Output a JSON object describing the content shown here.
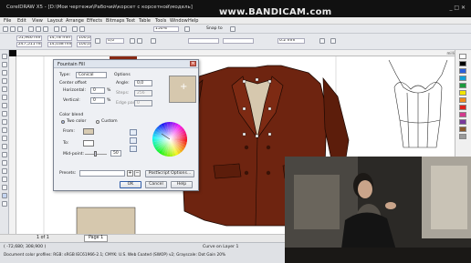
{
  "window": {
    "title": "CorelDRAW X5 - [D:\\Мои чертежи\\Рабочий\\корсет с корсетной\\модель]",
    "watermark": "www.BANDICAM.com",
    "controls": "_ □ ✕"
  },
  "menu": {
    "items": [
      "File",
      "Edit",
      "View",
      "Layout",
      "Arrange",
      "Effects",
      "Bitmaps",
      "Text",
      "Table",
      "Tools",
      "Window",
      "Help"
    ]
  },
  "toolbar": {
    "zoom_value": "150%",
    "snap_to_label": "Snap to",
    "outline_width": "0.2 mm"
  },
  "propertybar": {
    "x_value": "51,946 mm",
    "y_value": "247,511 mm",
    "width_value": "14,78 mm",
    "height_value": "14,038 mm",
    "scale_x": "100,0",
    "scale_y": "100,0",
    "rotation": "0,0"
  },
  "ruler": {
    "units_label": "millimeters"
  },
  "dialog": {
    "title": "Fountain Fill",
    "type_label": "Type:",
    "type_value": "Conical",
    "center_offset_label": "Center offset",
    "horizontal_label": "Horizontal:",
    "horizontal_value": "0",
    "vertical_label": "Vertical:",
    "vertical_value": "0",
    "percent_sign": "%",
    "options_label": "Options",
    "angle_label": "Angle:",
    "angle_value": "0,0",
    "steps_label": "Steps:",
    "steps_value": "256",
    "edge_pad_label": "Edge pad:",
    "edge_pad_value": "0",
    "color_blend_label": "Color blend",
    "two_color_label": "Two color",
    "custom_label": "Custom",
    "from_label": "From:",
    "to_label": "To:",
    "midpoint_label": "Mid-point:",
    "midpoint_value": "50",
    "presets_label": "Presets:",
    "postscript_button": "PostScript Options...",
    "ok_button": "OK",
    "cancel_button": "Cancel",
    "help_button": "Help",
    "preview_symbol": "+",
    "from_color": "#d8cbb2",
    "to_color": "#ffffff"
  },
  "pages": {
    "counter": "1 of 1",
    "page_tab": "Page 1"
  },
  "status": {
    "coords": "( -72,680; 308,900 )",
    "layer": "Curve on Layer 1",
    "profile": "Document color profiles: RGB: sRGB IEC61966-2.1; CMYK: U.S. Web Coated (SWOP) v2; Grayscale: Dot Gain 20%"
  },
  "colors": {
    "coat": "#6e2410",
    "coat_shadow": "#4a1608",
    "lining": "#d6c8ae",
    "selection_fill": "#8a2a14"
  },
  "icons": [
    "pick-tool-icon",
    "shape-tool-icon",
    "zoom-tool-icon",
    "freehand-tool-icon",
    "rectangle-tool-icon",
    "ellipse-tool-icon",
    "polygon-tool-icon",
    "text-tool-icon",
    "fill-tool-icon",
    "eyedropper-icon",
    "new-doc-icon",
    "open-icon",
    "save-icon",
    "undo-icon",
    "redo-icon",
    "close-icon"
  ]
}
